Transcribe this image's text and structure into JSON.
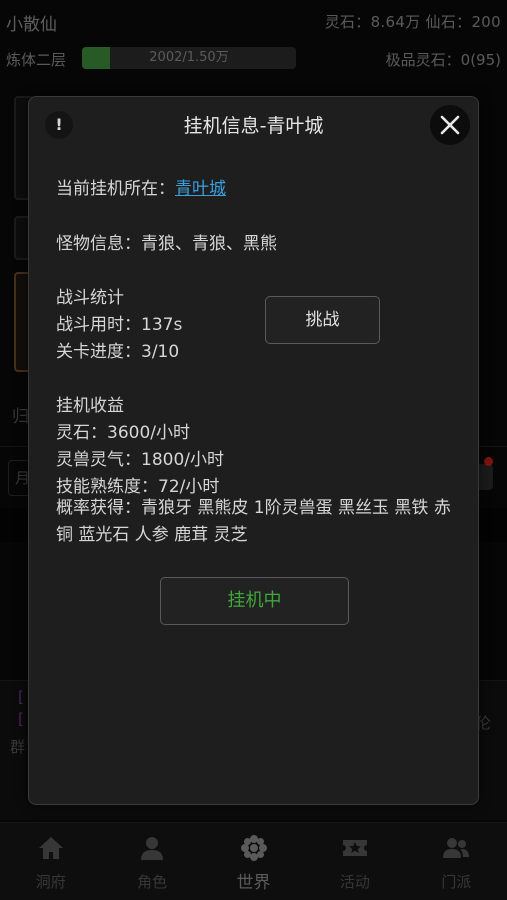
{
  "header": {
    "player_name": "小散仙",
    "resources_row1": "灵石：8.64万  仙石：200",
    "realm": "炼体二层",
    "exp_text": "2002/1.50万",
    "exp_progress": 0.133,
    "premium_stones": "极品灵石：0(95)"
  },
  "background": {
    "gui_label": "归",
    "input_char": "月",
    "chat_bracket_1": "[",
    "chat_bracket_2": "[",
    "chat_qun": "群",
    "chat_right": "伦"
  },
  "modal": {
    "info_symbol": "!",
    "title": "挂机信息-青叶城",
    "location_label": "当前挂机所在：",
    "location_value": "青叶城",
    "monsters": "怪物信息：青狼、青狼、黑熊",
    "battle_stats_title": "战斗统计",
    "battle_time": "战斗用时：137s",
    "stage_progress": "关卡进度：3/10",
    "challenge_button": "挑战",
    "income_title": "挂机收益",
    "income_stone": "灵石：3600/小时",
    "income_beast": "灵兽灵气：1800/小时",
    "income_skill": "技能熟练度：72/小时",
    "drops": "概率获得：青狼牙 黑熊皮 1阶灵兽蛋 黑丝玉 黑铁 赤铜 蓝光石 人参 鹿茸 灵芝",
    "idle_button": "挂机中"
  },
  "nav": [
    {
      "label": "洞府",
      "icon": "home-icon"
    },
    {
      "label": "角色",
      "icon": "person-icon"
    },
    {
      "label": "世界",
      "icon": "flower-icon"
    },
    {
      "label": "活动",
      "icon": "ticket-star-icon"
    },
    {
      "label": "门派",
      "icon": "group-icon"
    }
  ],
  "colors": {
    "accent_green": "#3fa83a",
    "link_blue": "#3aa0dc",
    "exp_fill": "#3d8b3a"
  }
}
